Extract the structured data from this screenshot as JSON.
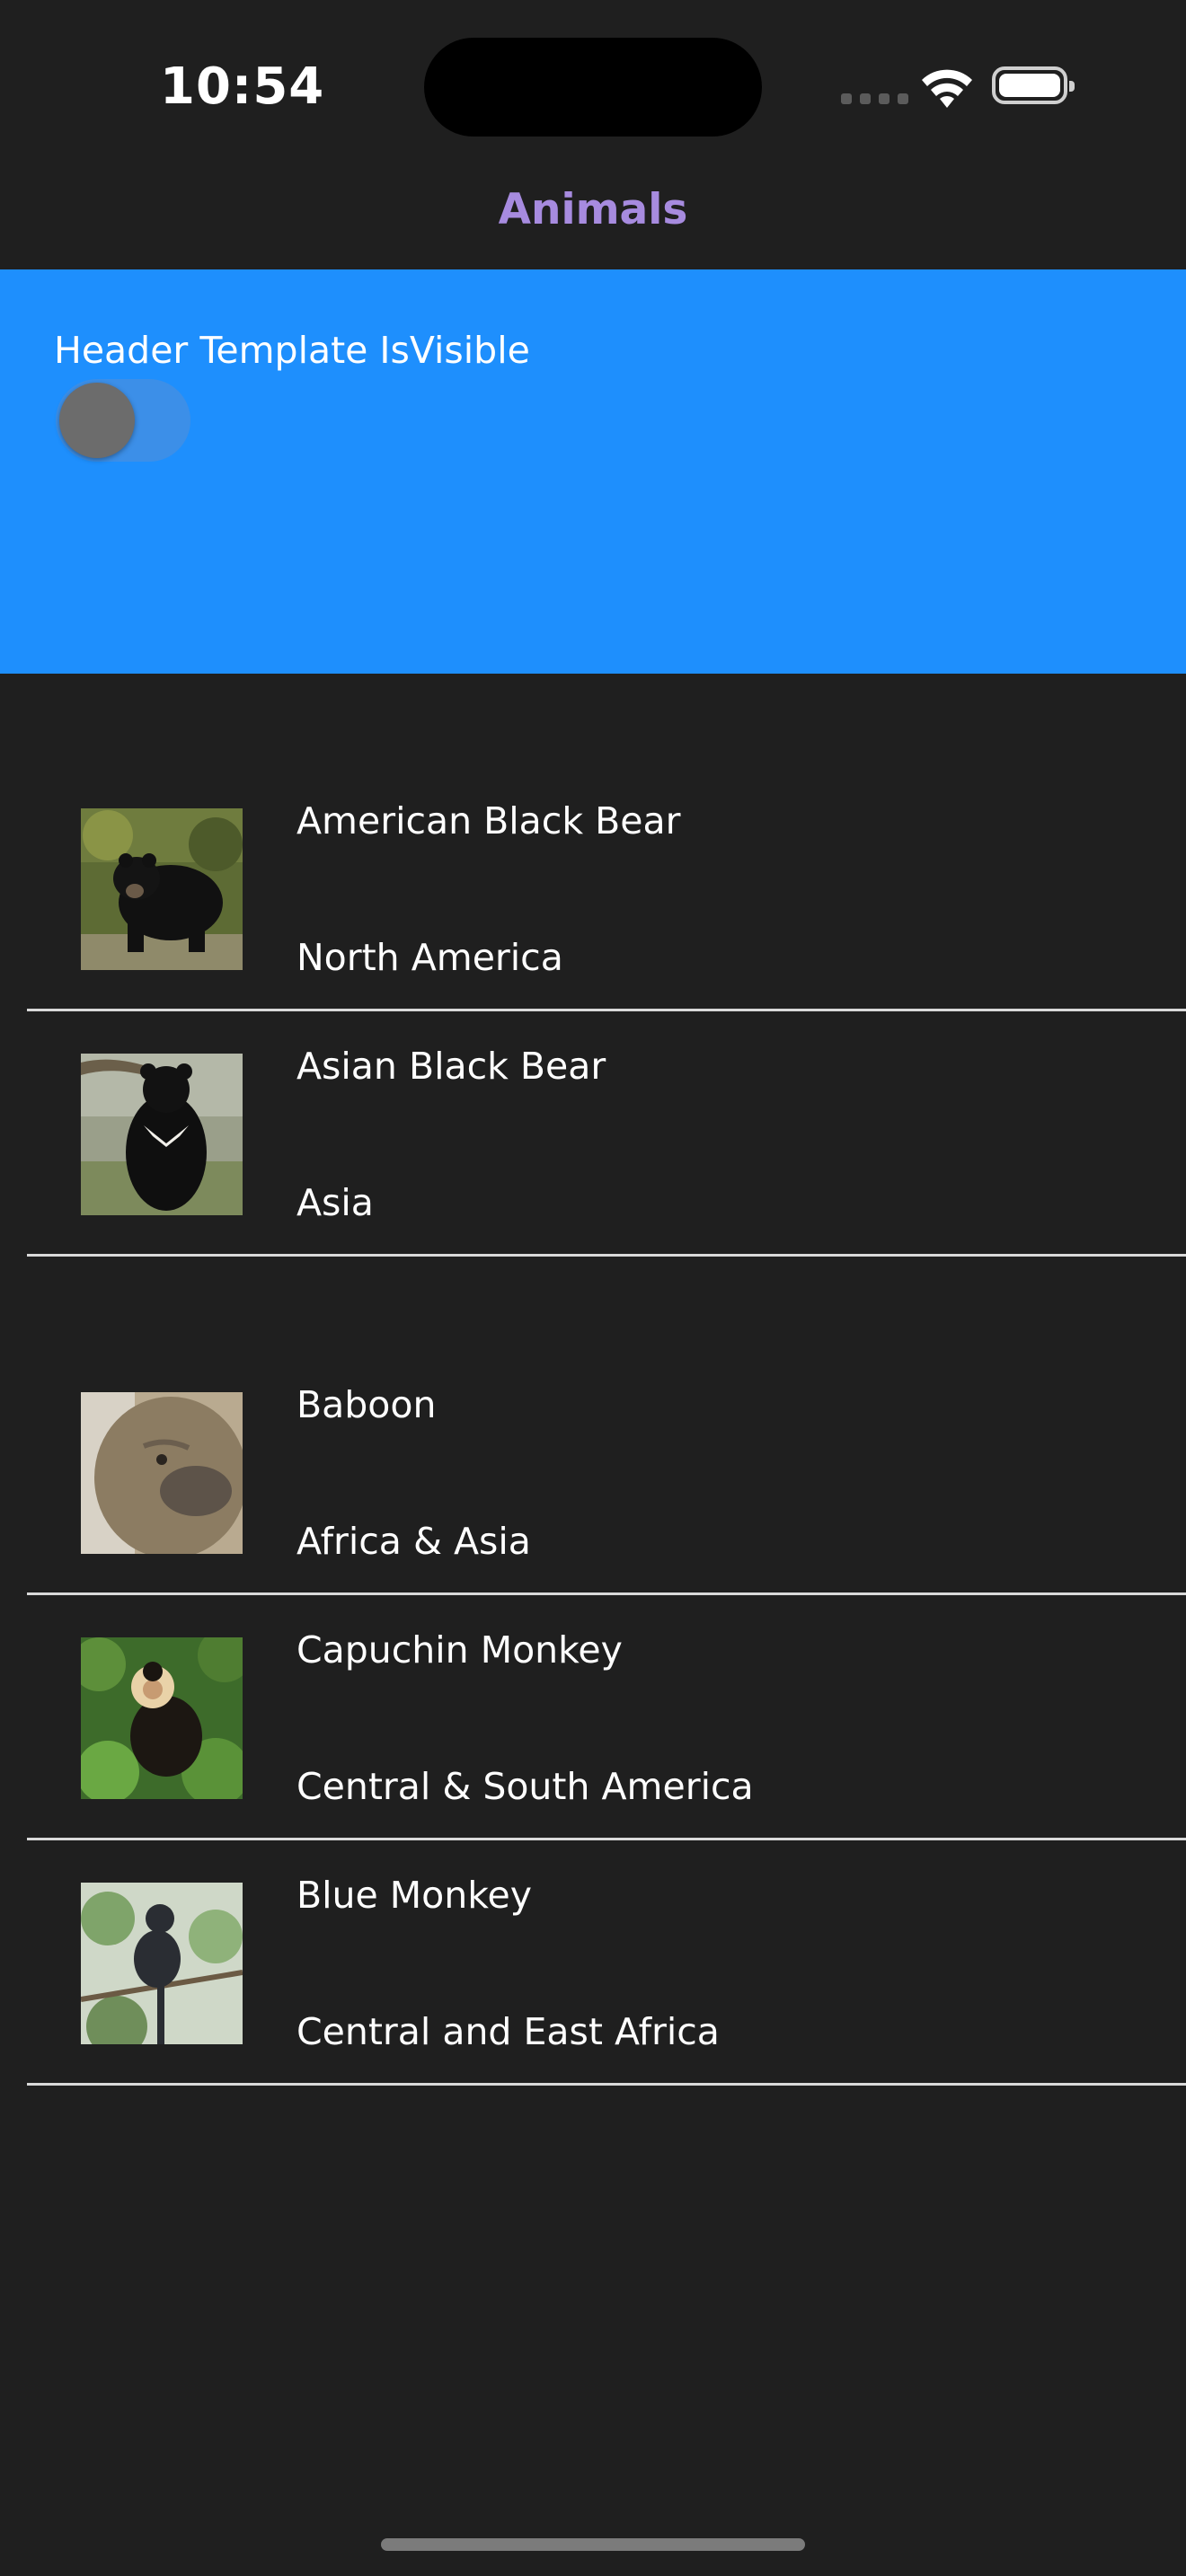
{
  "status_bar": {
    "time": "10:54"
  },
  "nav": {
    "title": "Animals"
  },
  "header": {
    "label": "Header Template IsVisible",
    "toggle_on": false
  },
  "groups": [
    {
      "items": [
        {
          "name": "American Black Bear",
          "location": "North America"
        },
        {
          "name": "Asian Black Bear",
          "location": "Asia"
        }
      ]
    },
    {
      "items": [
        {
          "name": "Baboon",
          "location": "Africa & Asia"
        },
        {
          "name": "Capuchin Monkey",
          "location": "Central & South America"
        },
        {
          "name": "Blue Monkey",
          "location": "Central and East Africa"
        }
      ]
    }
  ],
  "colors": {
    "background": "#1f1f1f",
    "header_background": "#1e8ffd",
    "nav_title": "#a78bdf",
    "divider": "#d9d9d9"
  }
}
